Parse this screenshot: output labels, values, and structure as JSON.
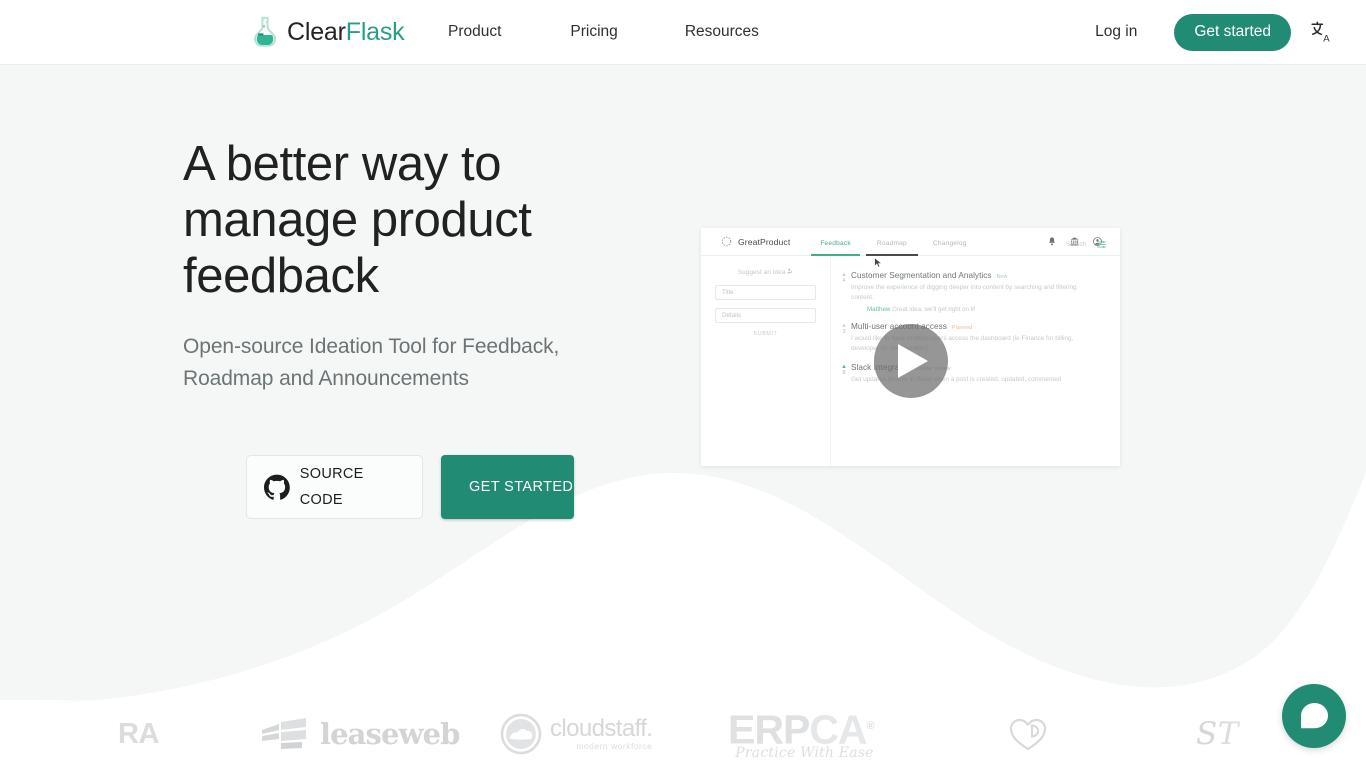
{
  "colors": {
    "accent": "#218b74",
    "accent_light": "#2a9d8a",
    "hero_bg": "#f4f7f6",
    "page_bg": "#ffffff",
    "heading": "#212121",
    "subtext": "#6d7476"
  },
  "navbar": {
    "brand_first": "Clear",
    "brand_second": "Flask",
    "brand_icon": "flask-icon",
    "links": [
      {
        "label": "Product"
      },
      {
        "label": "Pricing"
      },
      {
        "label": "Resources"
      }
    ],
    "login_label": "Log in",
    "get_started_label": "Get started",
    "language_icon": "translate-icon"
  },
  "hero": {
    "title": "A better way to manage product feedback",
    "subtitle": "Open-source Ideation Tool for Feedback, Roadmap and Announcements",
    "source_code_label": "SOURCE CODE",
    "source_code_icon": "github-icon",
    "get_started_label": "GET STARTED"
  },
  "demo": {
    "brand": "GreatProduct",
    "brand_icon": "dotted-circle-icon",
    "tabs": [
      {
        "label": "Feedback",
        "state": "active"
      },
      {
        "label": "Roadmap",
        "state": "hovered"
      },
      {
        "label": "Changelog",
        "state": "default"
      }
    ],
    "top_icons": [
      "bell-icon",
      "bank-icon",
      "account-icon"
    ],
    "cursor_icon": "cursor-arrow-icon",
    "form": {
      "suggest_label": "Suggest an idea",
      "suggest_icon": "person-add-icon",
      "title_placeholder": "Title",
      "details_placeholder": "Details",
      "submit_label": "SUBMIT"
    },
    "search_label": "Search",
    "filter_icon": "filter-icon",
    "posts": [
      {
        "votes": "4",
        "title": "Customer Segmentation and Analytics",
        "badge": "New",
        "badge_kind": "new",
        "description": "Improve the experience of digging deeper into content by searching and filtering content.",
        "reply_author": "Matthew",
        "reply_text": "Great idea, we'll get right on it!"
      },
      {
        "votes": "3",
        "title": "Multi-user account access",
        "badge": "Planned",
        "badge_kind": "planned",
        "description": "I would like to have multiple users access the dashboard (ie Finance for billing, developer for configuration)"
      },
      {
        "votes": "8",
        "title": "Slack Integration",
        "badge": "Under review",
        "badge_kind": "review",
        "description": "Get updates directly in Slack when a post is created, updated, commented"
      }
    ],
    "play_button_label": "play-button"
  },
  "logos": [
    {
      "name": "jira",
      "text": "RA"
    },
    {
      "name": "leaseweb",
      "text": "leaseweb"
    },
    {
      "name": "cloudstaff",
      "text": "cloudstaff.",
      "sub": "modern workforce"
    },
    {
      "name": "erpca",
      "text_dark": "ERP",
      "text_light": "CA",
      "reg": "®",
      "sub": "Practice With Ease"
    },
    {
      "name": "heart-logo",
      "text": ""
    },
    {
      "name": "st-logo",
      "text": "ST"
    }
  ],
  "chat": {
    "icon": "chat-bubble-icon",
    "label": "Open chat"
  }
}
